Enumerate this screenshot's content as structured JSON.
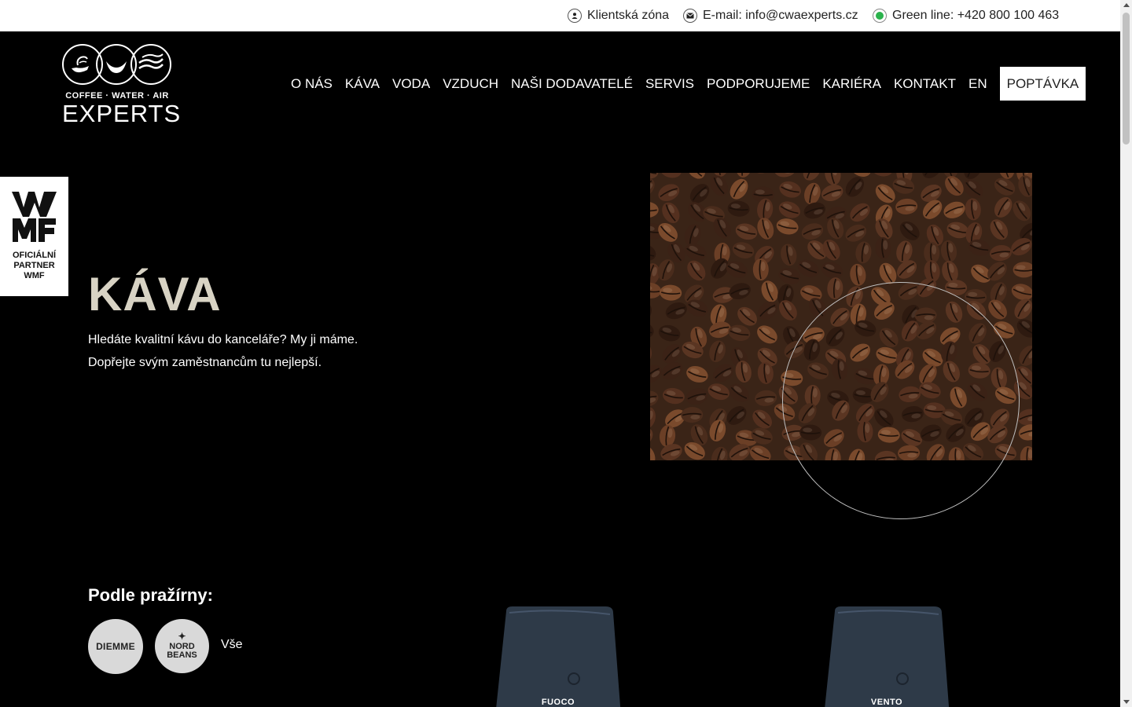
{
  "topbar": {
    "client_zone": "Klientská zóna",
    "email": "E-mail: info@cwaexperts.cz",
    "green_line": "Green line: +420 800 100 463"
  },
  "logo": {
    "tagline": "COFFEE · WATER · AIR",
    "name": "EXPERTS"
  },
  "nav": {
    "items": [
      "O NÁS",
      "KÁVA",
      "VODA",
      "VZDUCH",
      "NAŠI DODAVATELÉ",
      "SERVIS",
      "PODPORUJEME",
      "KARIÉRA",
      "KONTAKT",
      "EN"
    ],
    "cta": "POPTÁVKA"
  },
  "wmf_badge": {
    "logo_text": "WMF",
    "line1": "OFICIÁLNÍ",
    "line2": "PARTNER",
    "line3": "WMF"
  },
  "hero": {
    "title": "KÁVA",
    "line1": "Hledáte kvalitní kávu do kanceláře? My ji máme.",
    "line2": "Dopřejte svým zaměstnancům tu nejlepší."
  },
  "filters": {
    "title": "Podle pražírny:",
    "roaster1": "DIEMME",
    "roaster2_line1": "NORD",
    "roaster2_line2": "BEANS",
    "all": "Vše"
  },
  "products": {
    "p1": "FUOCO",
    "p2": "VENTO"
  },
  "colors": {
    "background": "#000000",
    "title_beige": "#d8d3c4",
    "green_dot": "#2bb24c",
    "bag_blue": "#2e3a48"
  }
}
